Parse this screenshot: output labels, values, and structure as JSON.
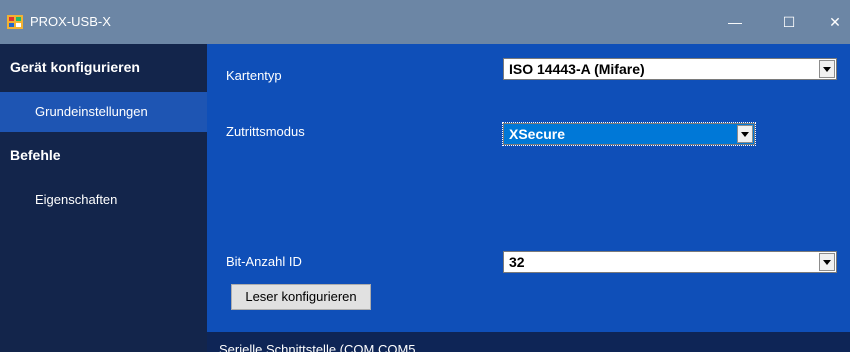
{
  "window": {
    "title": "PROX-USB-X",
    "minimize_glyph": "—",
    "maximize_glyph": "☐",
    "close_glyph": "✕"
  },
  "sidebar": {
    "groups": [
      {
        "label": "Gerät konfigurieren",
        "items": [
          {
            "label": "Grundeinstellungen",
            "active": true
          }
        ]
      },
      {
        "label": "Befehle",
        "items": [
          {
            "label": "Eigenschaften",
            "active": false
          }
        ]
      }
    ]
  },
  "form": {
    "kartentyp": {
      "label": "Kartentyp",
      "value": "ISO 14443-A (Mifare)"
    },
    "zutrittsmodus": {
      "label": "Zutrittsmodus",
      "value": "XSecure"
    },
    "bit_anzahl": {
      "label": "Bit-Anzahl ID",
      "value": "32"
    },
    "configure_button": "Leser konfigurieren"
  },
  "status": {
    "text": "Serielle Schnittstelle (COM COM5"
  },
  "colors": {
    "titlebar": "#6c86a5",
    "sidebar": "#13254b",
    "sidebar_active": "#1e55b3",
    "main": "#0f4fb8",
    "status": "#0e2556",
    "selected": "#0078d7"
  },
  "icons": {
    "app": "app-icon",
    "dropdown": "chevron-down-icon"
  }
}
